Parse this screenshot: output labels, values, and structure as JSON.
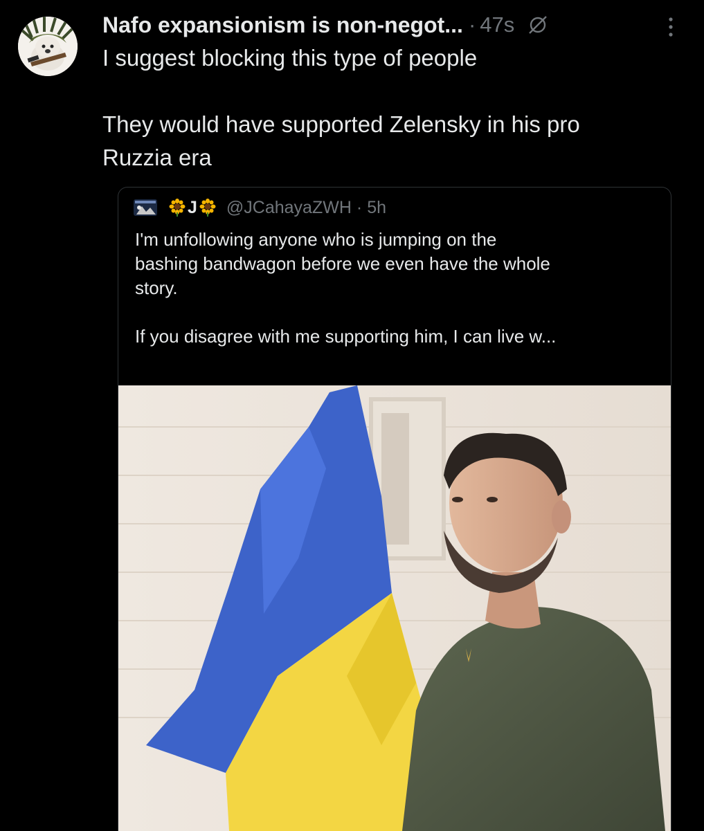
{
  "tweet": {
    "display_name": "Nafo expansionism is non-negot...",
    "separator": "·",
    "time": "47s",
    "text_lines": [
      "I suggest blocking this type of people",
      "",
      "They would have supported Zelensky in his pro",
      "Ruzzia era"
    ],
    "icons": {
      "avatar": "avatar",
      "mute": "mute-icon",
      "more": "more-options-icon"
    }
  },
  "quote": {
    "name": "J",
    "name_emoji": "sunflower-icon",
    "handle": "@JCahayaZWH",
    "separator": "·",
    "time": "5h",
    "text_lines": [
      "I'm unfollowing anyone who is jumping on the",
      "bashing bandwagon before we even have the whole",
      "story.",
      "",
      "If you disagree with me supporting him, I can live w..."
    ],
    "media": "photo of a man in an olive sweater beside a blue and yellow flag"
  },
  "colors": {
    "background": "#000000",
    "text_primary": "#e7e9ea",
    "text_secondary": "#71767b",
    "border": "#2f3336",
    "flag_blue": "#3d63c9",
    "flag_yellow": "#f3d643"
  }
}
